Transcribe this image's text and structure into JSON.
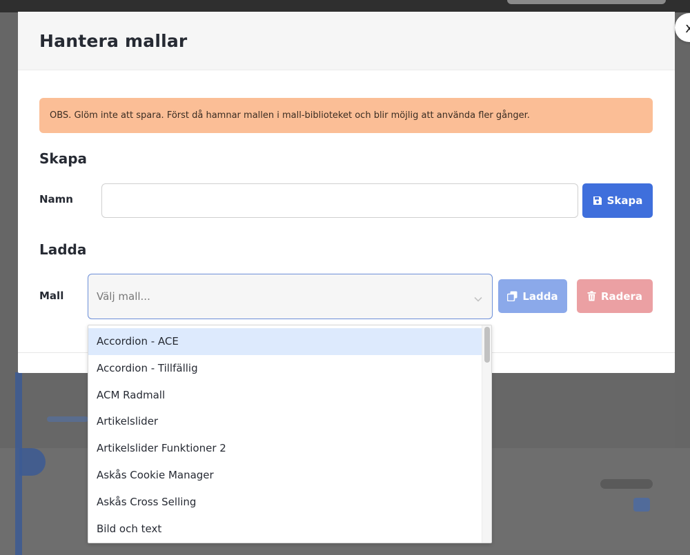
{
  "modal": {
    "title": "Hantera mallar",
    "close_label": "x",
    "alert_text": "OBS. Glöm inte att spara. Först då hamnar mallen i mall-biblioteket och blir möjlig att använda fler gånger.",
    "create": {
      "heading": "Skapa",
      "name_label": "Namn",
      "name_value": "",
      "button_label": "Skapa",
      "button_icon": "save-icon"
    },
    "load": {
      "heading": "Ladda",
      "template_label": "Mall",
      "select_placeholder": "Välj mall...",
      "load_button_label": "Ladda",
      "load_button_icon": "copy-icon",
      "delete_button_label": "Radera",
      "delete_button_icon": "trash-icon"
    }
  },
  "dropdown": {
    "items": [
      "Accordion - ACE",
      "Accordion - Tillfällig",
      "ACM Radmall",
      "Artikelslider",
      "Artikelslider Funktioner 2",
      "Askås Cookie Manager",
      "Askås Cross Selling",
      "Bild och text"
    ],
    "highlighted_index": 0
  },
  "colors": {
    "primary": "#3f6fdc",
    "load_button": "#8ba9ea",
    "delete_button": "#eba0a3",
    "alert_bg": "#fbbe96",
    "highlight": "#ddeafd"
  }
}
